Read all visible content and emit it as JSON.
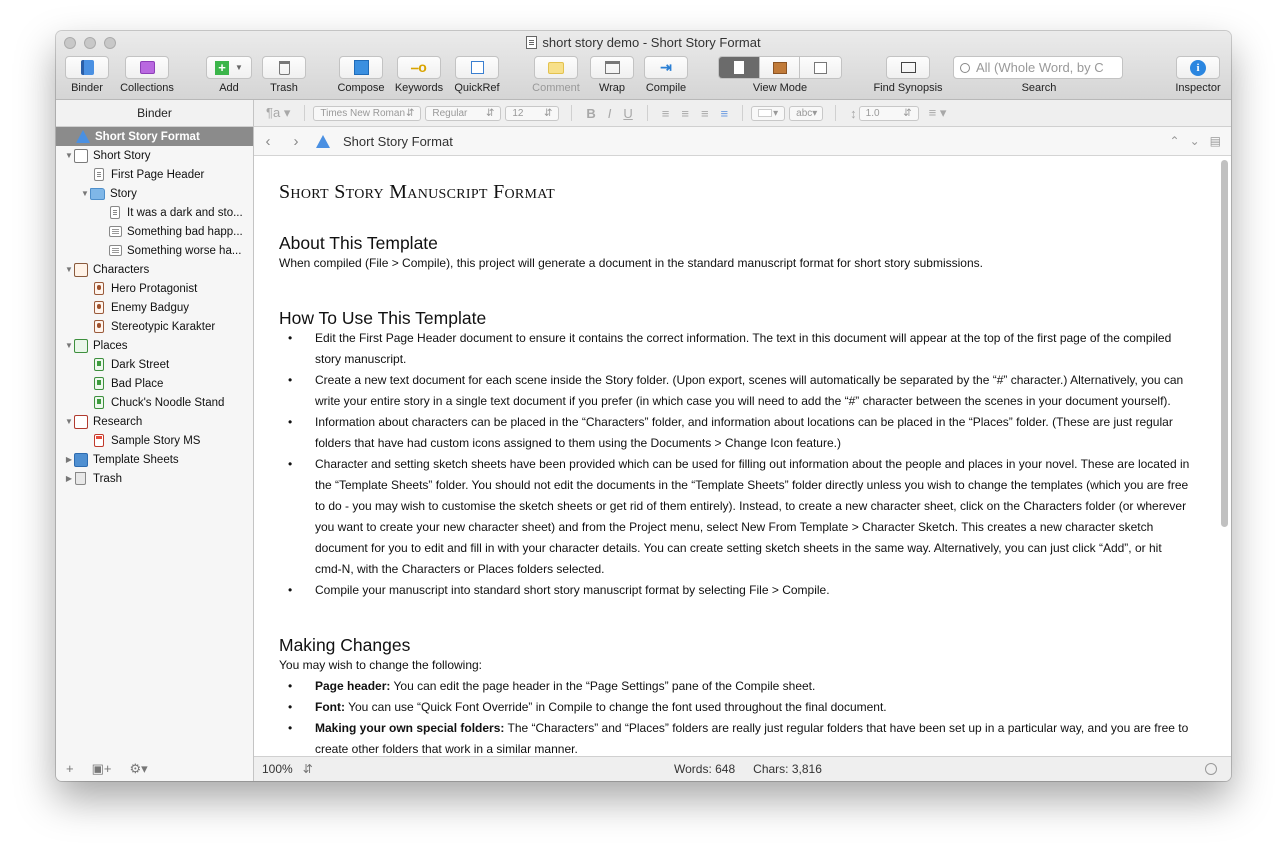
{
  "window": {
    "title": "short story demo - Short Story Format"
  },
  "toolbar": {
    "binder": "Binder",
    "collections": "Collections",
    "add": "Add",
    "trash": "Trash",
    "compose": "Compose",
    "keywords": "Keywords",
    "quickref": "QuickRef",
    "comment": "Comment",
    "wrap": "Wrap",
    "compile": "Compile",
    "view_mode": "View Mode",
    "find_synopsis": "Find Synopsis",
    "search": "Search",
    "search_placeholder": "All (Whole Word, by C",
    "inspector": "Inspector"
  },
  "format_bar": {
    "font": "Times New Roman",
    "style": "Regular",
    "size": "12",
    "line_spacing": "1.0",
    "highlight": "abc"
  },
  "binder": {
    "header": "Binder",
    "items": [
      {
        "label": "Short Story Format",
        "level": 0,
        "icon": "warning-icon",
        "selected": true
      },
      {
        "label": "Short Story",
        "level": 0,
        "icon": "manuscript-icon",
        "expanded": true
      },
      {
        "label": "First Page Header",
        "level": 1,
        "icon": "document-icon"
      },
      {
        "label": "Story",
        "level": 1,
        "icon": "folder-icon",
        "expanded": true
      },
      {
        "label": "It was a dark and sto...",
        "level": 2,
        "icon": "document-icon"
      },
      {
        "label": "Something bad happ...",
        "level": 2,
        "icon": "text-icon"
      },
      {
        "label": "Something worse ha...",
        "level": 2,
        "icon": "text-icon"
      },
      {
        "label": "Characters",
        "level": 0,
        "icon": "characters-folder-icon",
        "expanded": true
      },
      {
        "label": "Hero Protagonist",
        "level": 1,
        "icon": "character-sheet-icon"
      },
      {
        "label": "Enemy Badguy",
        "level": 1,
        "icon": "character-sheet-icon"
      },
      {
        "label": "Stereotypic Karakter",
        "level": 1,
        "icon": "character-sheet-icon"
      },
      {
        "label": "Places",
        "level": 0,
        "icon": "places-folder-icon",
        "expanded": true
      },
      {
        "label": "Dark Street",
        "level": 1,
        "icon": "place-sheet-icon"
      },
      {
        "label": "Bad Place",
        "level": 1,
        "icon": "place-sheet-icon"
      },
      {
        "label": "Chuck's Noodle Stand",
        "level": 1,
        "icon": "place-sheet-icon"
      },
      {
        "label": "Research",
        "level": 0,
        "icon": "research-folder-icon",
        "expanded": true
      },
      {
        "label": "Sample Story MS",
        "level": 1,
        "icon": "research-doc-icon"
      },
      {
        "label": "Template Sheets",
        "level": 0,
        "icon": "template-sheets-icon",
        "expanded": false
      },
      {
        "label": "Trash",
        "level": 0,
        "icon": "trash-icon",
        "expanded": false
      }
    ]
  },
  "editor": {
    "header_title": "Short Story Format",
    "doc_title": "Short Story Manuscript Format",
    "about_heading": "About This Template",
    "about_text": "When compiled (File > Compile), this project will generate a document in the standard manuscript format for short story submissions.",
    "howto_heading": "How To Use This Template",
    "howto_bullets": [
      "Edit the First Page Header document to ensure it contains the correct information. The text in this document will appear at the top of the first page of the compiled story manuscript.",
      "Create a new text document for each scene inside the Story folder. (Upon export, scenes will automatically be separated by the “#” character.) Alternatively, you can write your entire story in a single text document if you prefer (in which case you will need to add the “#” character between the scenes in your document yourself).",
      "Information about characters can be placed in the “Characters” folder, and information about locations can be placed in the “Places” folder. (These are just regular folders that have had custom icons assigned to them using the Documents > Change Icon feature.)",
      "Character and setting sketch sheets have been provided which can be used for filling out information about the people and places in your novel. These are located in the “Template Sheets” folder. You should not edit the documents in the “Template Sheets” folder directly unless you wish to change the templates (which you are free to do - you may wish to customise the sketch sheets or get rid of them entirely). Instead, to create a new character sheet, click on the Characters folder (or wherever you want to create your new character sheet) and from the Project menu, select New From Template > Character Sketch. This creates a new character sketch document for you to edit and fill in with your character details. You can create setting sketch sheets in the same way. Alternatively, you can just click “Add”, or hit cmd-N, with the Characters or Places folders selected.",
      "Compile your manuscript into standard short story manuscript format by selecting File > Compile."
    ],
    "changes_heading": "Making Changes",
    "changes_intro": "You may wish to change the following:",
    "changes_bullets": [
      {
        "term": "Page header:",
        "text": " You can edit the page header in the “Page Settings” pane of the Compile sheet."
      },
      {
        "term": "Font:",
        "text": " You can use “Quick Font Override” in Compile to change the font used throughout the final document."
      },
      {
        "term": "Making your own special folders:",
        "text": " The “Characters” and “Places” folders are really just regular folders that have been set up in a particular way, and you are free to create other folders that work in a similar manner."
      }
    ]
  },
  "status": {
    "zoom": "100%",
    "words": "Words: 648",
    "chars": "Chars: 3,816"
  }
}
